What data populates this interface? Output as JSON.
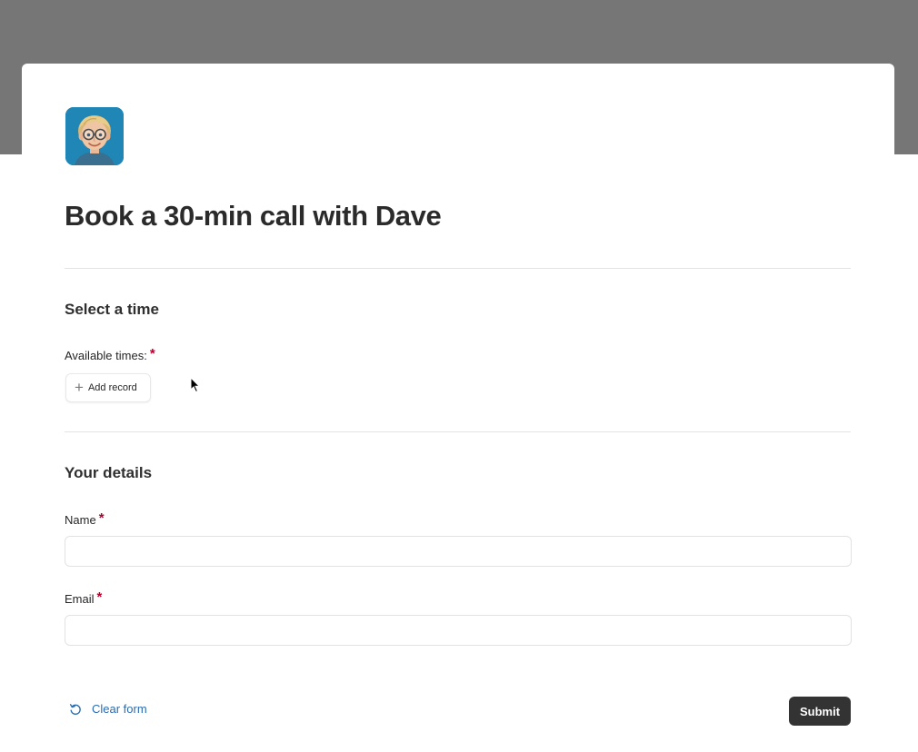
{
  "form": {
    "title": "Book a 30-min call with Dave",
    "avatar_icon": "memoji-avatar",
    "sections": {
      "time": {
        "heading": "Select a time",
        "available_times_label": "Available times:",
        "add_record_label": "Add record",
        "add_record_icon": "plus-icon"
      },
      "details": {
        "heading": "Your details",
        "name_label": "Name",
        "name_value": "",
        "email_label": "Email",
        "email_value": ""
      }
    },
    "required_marker": "*",
    "clear_form_label": "Clear form",
    "clear_form_icon": "undo-icon",
    "submit_label": "Submit"
  },
  "colors": {
    "backdrop": "#767676",
    "required": "#b3002d",
    "link": "#2a6cb0",
    "submit_bg": "#333333"
  }
}
